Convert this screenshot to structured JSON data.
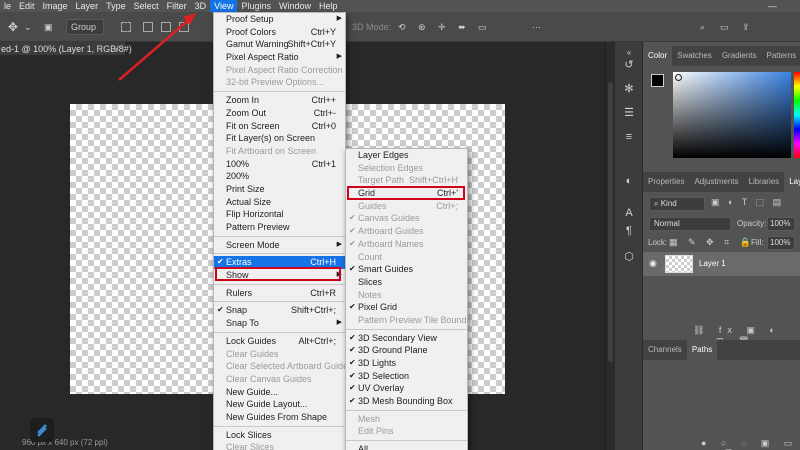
{
  "menubar": {
    "items": [
      "le",
      "Edit",
      "Image",
      "Layer",
      "Type",
      "Select",
      "Filter",
      "3D",
      "View",
      "Plugins",
      "Window",
      "Help"
    ],
    "active_index": 8,
    "minimize": "—"
  },
  "optionsbar": {
    "auto_select_value": "Group",
    "mode_3d_label": "3D Mode:"
  },
  "document_tab": {
    "title": "ed-1 @ 100% (Layer 1, RGB/8#)",
    "close": "×"
  },
  "status": {
    "text": "960 px x 640 px (72 ppi)"
  },
  "view_menu": {
    "items": [
      {
        "label": "Proof Setup",
        "shortcut": "",
        "submenu": true
      },
      {
        "label": "Proof Colors",
        "shortcut": "Ctrl+Y"
      },
      {
        "label": "Gamut Warning",
        "shortcut": "Shift+Ctrl+Y"
      },
      {
        "label": "Pixel Aspect Ratio",
        "shortcut": "",
        "submenu": true
      },
      {
        "label": "Pixel Aspect Ratio Correction",
        "shortcut": "",
        "disabled": true
      },
      {
        "label": "32-bit Preview Options...",
        "shortcut": "",
        "disabled": true
      },
      {
        "sep": true
      },
      {
        "label": "Zoom In",
        "shortcut": "Ctrl++"
      },
      {
        "label": "Zoom Out",
        "shortcut": "Ctrl+-"
      },
      {
        "label": "Fit on Screen",
        "shortcut": "Ctrl+0"
      },
      {
        "label": "Fit Layer(s) on Screen",
        "shortcut": ""
      },
      {
        "label": "Fit Artboard on Screen",
        "shortcut": "",
        "disabled": true
      },
      {
        "label": "100%",
        "shortcut": "Ctrl+1"
      },
      {
        "label": "200%",
        "shortcut": ""
      },
      {
        "label": "Print Size",
        "shortcut": ""
      },
      {
        "label": "Actual Size",
        "shortcut": ""
      },
      {
        "label": "Flip Horizontal",
        "shortcut": ""
      },
      {
        "label": "Pattern Preview",
        "shortcut": ""
      },
      {
        "sep": true
      },
      {
        "label": "Screen Mode",
        "shortcut": "",
        "submenu": true
      },
      {
        "sep": true
      },
      {
        "label": "Extras",
        "shortcut": "Ctrl+H",
        "checked": true,
        "highlighted": true
      },
      {
        "label": "Show",
        "shortcut": "",
        "submenu": true
      },
      {
        "sep": true
      },
      {
        "label": "Rulers",
        "shortcut": "Ctrl+R"
      },
      {
        "sep": true
      },
      {
        "label": "Snap",
        "shortcut": "Shift+Ctrl+;",
        "checked": true
      },
      {
        "label": "Snap To",
        "shortcut": "",
        "submenu": true
      },
      {
        "sep": true
      },
      {
        "label": "Lock Guides",
        "shortcut": "Alt+Ctrl+;"
      },
      {
        "label": "Clear Guides",
        "shortcut": "",
        "disabled": true
      },
      {
        "label": "Clear Selected Artboard Guides",
        "shortcut": "",
        "disabled": true
      },
      {
        "label": "Clear Canvas Guides",
        "shortcut": "",
        "disabled": true
      },
      {
        "label": "New Guide...",
        "shortcut": ""
      },
      {
        "label": "New Guide Layout...",
        "shortcut": ""
      },
      {
        "label": "New Guides From Shape",
        "shortcut": ""
      },
      {
        "sep": true
      },
      {
        "label": "Lock Slices",
        "shortcut": ""
      },
      {
        "label": "Clear Slices",
        "shortcut": "",
        "disabled": true
      }
    ]
  },
  "show_menu": {
    "items": [
      {
        "label": "Layer Edges",
        "shortcut": ""
      },
      {
        "label": "Selection Edges",
        "shortcut": "",
        "disabled": true
      },
      {
        "label": "Target Path",
        "shortcut": "Shift+Ctrl+H",
        "disabled": true
      },
      {
        "label": "Grid",
        "shortcut": "Ctrl+'"
      },
      {
        "label": "Guides",
        "shortcut": "Ctrl+;",
        "disabled": true
      },
      {
        "label": "Canvas Guides",
        "shortcut": "",
        "checked": true,
        "disabled": true
      },
      {
        "label": "Artboard Guides",
        "shortcut": "",
        "checked": true,
        "disabled": true
      },
      {
        "label": "Artboard Names",
        "shortcut": "",
        "checked": true,
        "disabled": true
      },
      {
        "label": "Count",
        "shortcut": "",
        "disabled": true
      },
      {
        "label": "Smart Guides",
        "shortcut": "",
        "checked": true
      },
      {
        "label": "Slices",
        "shortcut": ""
      },
      {
        "label": "Notes",
        "shortcut": "",
        "disabled": true
      },
      {
        "label": "Pixel Grid",
        "shortcut": "",
        "checked": true
      },
      {
        "label": "Pattern Preview Tile Bounds",
        "shortcut": "",
        "disabled": true
      },
      {
        "sep": true
      },
      {
        "label": "3D Secondary View",
        "shortcut": "",
        "checked": true
      },
      {
        "label": "3D Ground Plane",
        "shortcut": "",
        "checked": true
      },
      {
        "label": "3D Lights",
        "shortcut": "",
        "checked": true
      },
      {
        "label": "3D Selection",
        "shortcut": "",
        "checked": true
      },
      {
        "label": "UV Overlay",
        "shortcut": "",
        "checked": true
      },
      {
        "label": "3D Mesh Bounding Box",
        "shortcut": "",
        "checked": true
      },
      {
        "sep": true
      },
      {
        "label": "Mesh",
        "shortcut": "",
        "disabled": true
      },
      {
        "label": "Edit Pins",
        "shortcut": "",
        "disabled": true
      },
      {
        "sep": true
      },
      {
        "label": "All",
        "shortcut": ""
      }
    ]
  },
  "panels": {
    "color_tabs": [
      "Color",
      "Swatches",
      "Gradients",
      "Patterns"
    ],
    "layers_tabs": [
      "Properties",
      "Adjustments",
      "Libraries",
      "Laye"
    ],
    "filter_kind": "Kind",
    "blend_mode": "Normal",
    "opacity_label": "Opacity:",
    "opacity_value": "100%",
    "lock_label": "Lock:",
    "fill_label": "Fill:",
    "fill_value": "100%",
    "layer_name": "Layer 1",
    "bottom_tabs": [
      "Channels",
      "Paths"
    ]
  },
  "colors": {
    "accent": "#1473e6",
    "highlight_box": "#d0021b",
    "arrow": "#e02020"
  }
}
